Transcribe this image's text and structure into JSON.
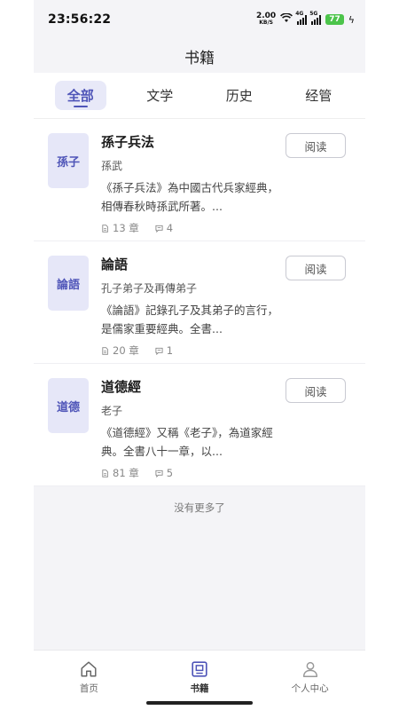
{
  "status_bar": {
    "time": "23:56:22",
    "net_speed_value": "2.00",
    "net_speed_unit": "KB/S",
    "signal1_tag": "4G",
    "signal2_tag": "5G",
    "battery": "77",
    "bolt": "ϟ"
  },
  "header": {
    "title": "书籍"
  },
  "tabs": [
    {
      "label": "全部",
      "active": true
    },
    {
      "label": "文学"
    },
    {
      "label": "历史"
    },
    {
      "label": "经管"
    }
  ],
  "books": [
    {
      "cover_text": "孫子",
      "title": "孫子兵法",
      "author": "孫武",
      "desc": "《孫子兵法》為中國古代兵家經典，相傳春秋時孫武所著。...",
      "chapters": "13 章",
      "comments": "4",
      "action": "阅读"
    },
    {
      "cover_text": "論語",
      "title": "論語",
      "author": "孔子弟子及再傳弟子",
      "desc": "《論語》記錄孔子及其弟子的言行，是儒家重要經典。全書...",
      "chapters": "20 章",
      "comments": "1",
      "action": "阅读"
    },
    {
      "cover_text": "道德",
      "title": "道德經",
      "author": "老子",
      "desc": "《道德經》又稱《老子》，為道家經典。全書八十一章，以...",
      "chapters": "81 章",
      "comments": "5",
      "action": "阅读"
    }
  ],
  "list_footer": "没有更多了",
  "bottom_nav": [
    {
      "label": "首页",
      "icon": "home-icon"
    },
    {
      "label": "书籍",
      "icon": "book-icon",
      "active": true
    },
    {
      "label": "个人中心",
      "icon": "user-icon"
    }
  ],
  "colors": {
    "accent": "#4f55b8",
    "accent_bg": "#e6e7f8",
    "battery": "#4cc44b"
  }
}
